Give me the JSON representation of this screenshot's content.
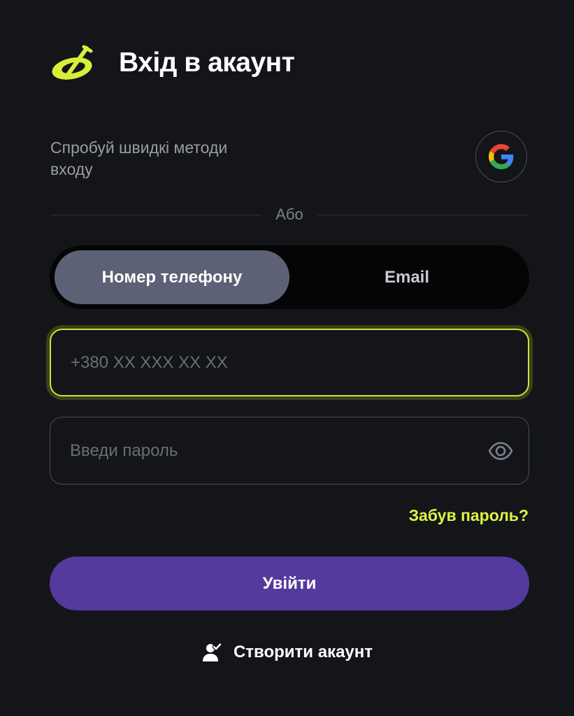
{
  "header": {
    "title": "Вхід в акаунт",
    "logo_icon": "brand-logo-icon",
    "accent_color": "#d8ef3a"
  },
  "quick_login": {
    "text": "Спробуй швидкі методи входу",
    "google_icon": "google-icon"
  },
  "divider": {
    "label": "Або"
  },
  "method_toggle": {
    "tabs": [
      {
        "label": "Номер телефону",
        "active": true
      },
      {
        "label": "Email",
        "active": false
      }
    ]
  },
  "form": {
    "phone": {
      "value": "",
      "placeholder": "+380 XX XXX XX XX"
    },
    "password": {
      "value": "",
      "placeholder": "Введи пароль",
      "toggle_icon": "eye-icon"
    },
    "forgot_label": "Забув пароль?",
    "submit_label": "Увійти"
  },
  "footer": {
    "create_account_label": "Створити акаунт",
    "create_account_icon": "user-check-icon"
  },
  "colors": {
    "background": "#141519",
    "primary_button": "#543a9c",
    "highlight": "#e0f244",
    "active_tab": "#5d6175"
  }
}
